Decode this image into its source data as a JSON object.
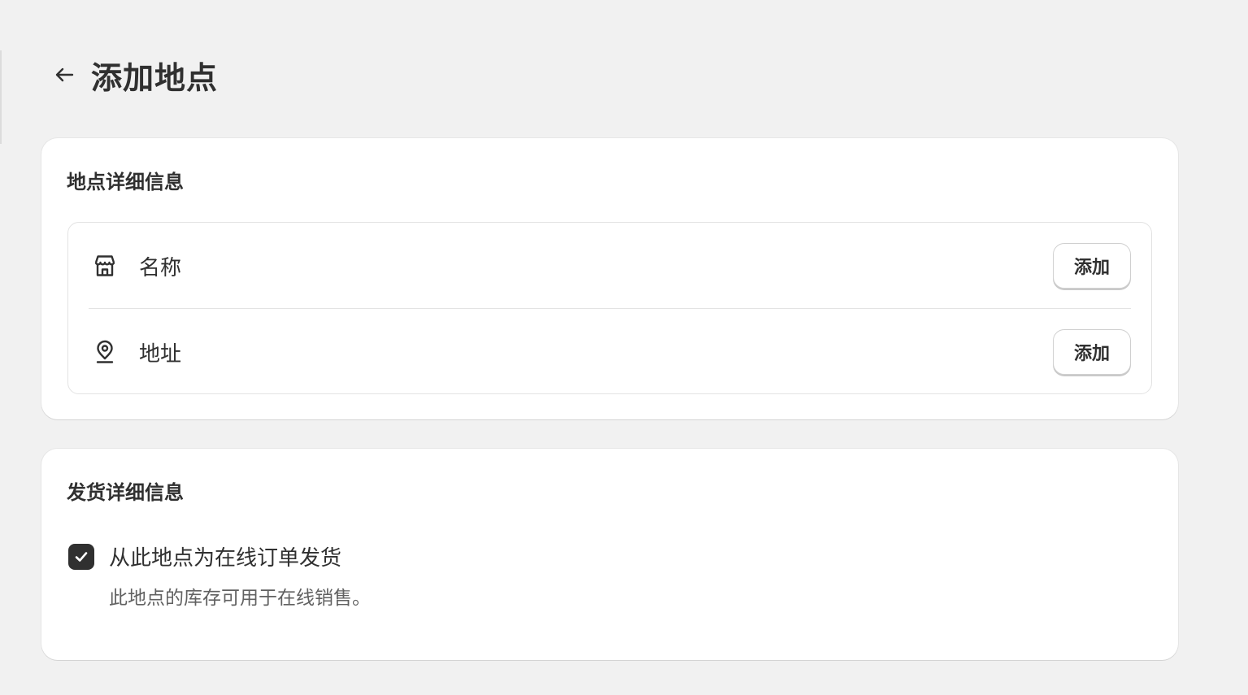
{
  "page": {
    "title": "添加地点"
  },
  "location_card": {
    "title": "地点详细信息",
    "rows": [
      {
        "icon": "store-icon",
        "label": "名称",
        "button_label": "添加"
      },
      {
        "icon": "location-pin-icon",
        "label": "地址",
        "button_label": "添加"
      }
    ]
  },
  "shipping_card": {
    "title": "发货详细信息",
    "checkbox": {
      "checked": true,
      "label": "从此地点为在线订单发货",
      "help_text": "此地点的库存可用于在线销售。"
    }
  },
  "colors": {
    "background": "#f1f1f1",
    "card": "#ffffff",
    "text": "#303030",
    "muted_text": "#616161",
    "checkbox_fill": "#303030"
  }
}
